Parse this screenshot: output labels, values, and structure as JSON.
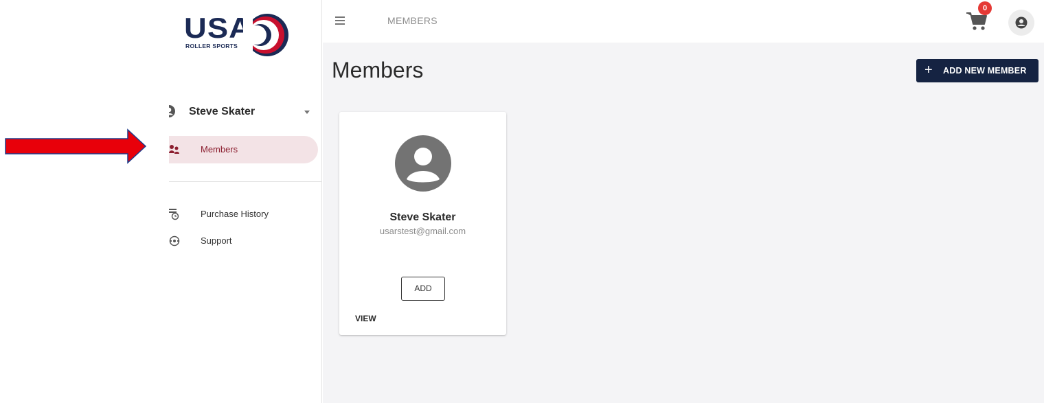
{
  "logo": {
    "wordmark": "USA",
    "subtitle": "ROLLER SPORTS"
  },
  "sidebar": {
    "user_name": "Steve Skater",
    "items": [
      {
        "label": "Members",
        "icon": "members-icon",
        "active": true
      },
      {
        "label": "Purchase History",
        "icon": "receipt-clock-icon",
        "active": false
      },
      {
        "label": "Support",
        "icon": "support-icon",
        "active": false
      }
    ]
  },
  "topbar": {
    "title": "MEMBERS",
    "cart_count": "0"
  },
  "main": {
    "page_title": "Members",
    "add_button_label": "ADD NEW MEMBER",
    "card": {
      "name": "Steve Skater",
      "email": "usarstest@gmail.com",
      "add_label": "ADD",
      "view_label": "VIEW"
    }
  },
  "colors": {
    "accent": "#152342",
    "active_bg": "#f3e3e6",
    "active_text": "#8b1e2f",
    "badge": "#e53935",
    "arrow": "#e8000a"
  }
}
